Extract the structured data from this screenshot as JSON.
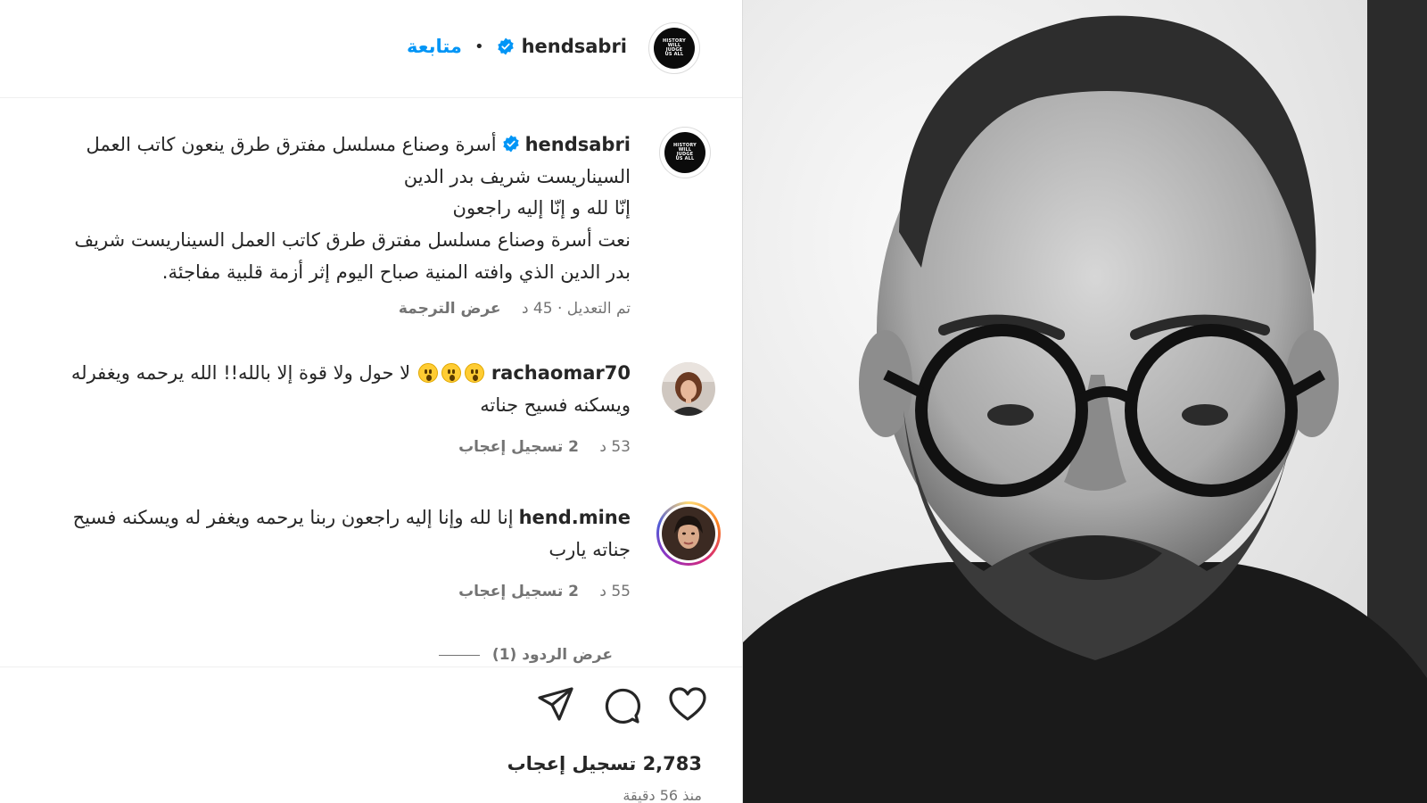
{
  "header": {
    "username": "hendsabri",
    "follow_label": "متابعة",
    "separator": "•"
  },
  "owner_avatar": {
    "logo_lines": [
      "HISTORY",
      "WILL",
      "JUDGE",
      "US ALL"
    ]
  },
  "caption": {
    "username": "hendsabri",
    "lines": [
      "أسرة وصناع مسلسل مفترق طرق ينعون كاتب العمل",
      "السيناريست شريف بدر الدين",
      "إنّا لله و إنّا إليه راجعون",
      "نعت أسرة وصناع مسلسل مفترق طرق كاتب العمل السيناريست شريف",
      "بدر الدين الذي وافته المنية صباح اليوم إثر أزمة قلبية مفاجئة."
    ],
    "edited_label": "تم التعديل",
    "time": "45 د",
    "translation_label": "عرض الترجمة"
  },
  "comments": [
    {
      "username": "rachaomar70",
      "text_line1": "لا حول ولا قوة إلا بالله!! الله يرحمه ويغفرله",
      "text_line2": "ويسكنه فسيح جناته",
      "emoji": [
        "hushed-face-emoji",
        "hushed-face-emoji",
        "hushed-face-emoji"
      ],
      "time": "53 د",
      "likes": "2 تسجيل إعجاب"
    },
    {
      "username": "hend.mine",
      "text_line1": "إنا لله وإنا إليه راجعون ربنا يرحمه ويغفر له ويسكنه فسيح",
      "text_line2": "جناته يارب",
      "time": "55 د",
      "likes": "2 تسجيل إعجاب"
    }
  ],
  "view_replies_label": "عرض الردود (1)",
  "footer": {
    "likes_count": "2,783 تسجيل إعجاب",
    "time_ago": "منذ 56 دقيقة"
  },
  "icons": {
    "heart": "heart-icon",
    "comment": "comment-icon",
    "share": "share-icon",
    "verified": "verified-badge-icon"
  },
  "colors": {
    "accent_blue": "#0095f6",
    "verified_blue": "#0095f6",
    "secondary_text": "#737373",
    "primary_text": "#262626"
  }
}
